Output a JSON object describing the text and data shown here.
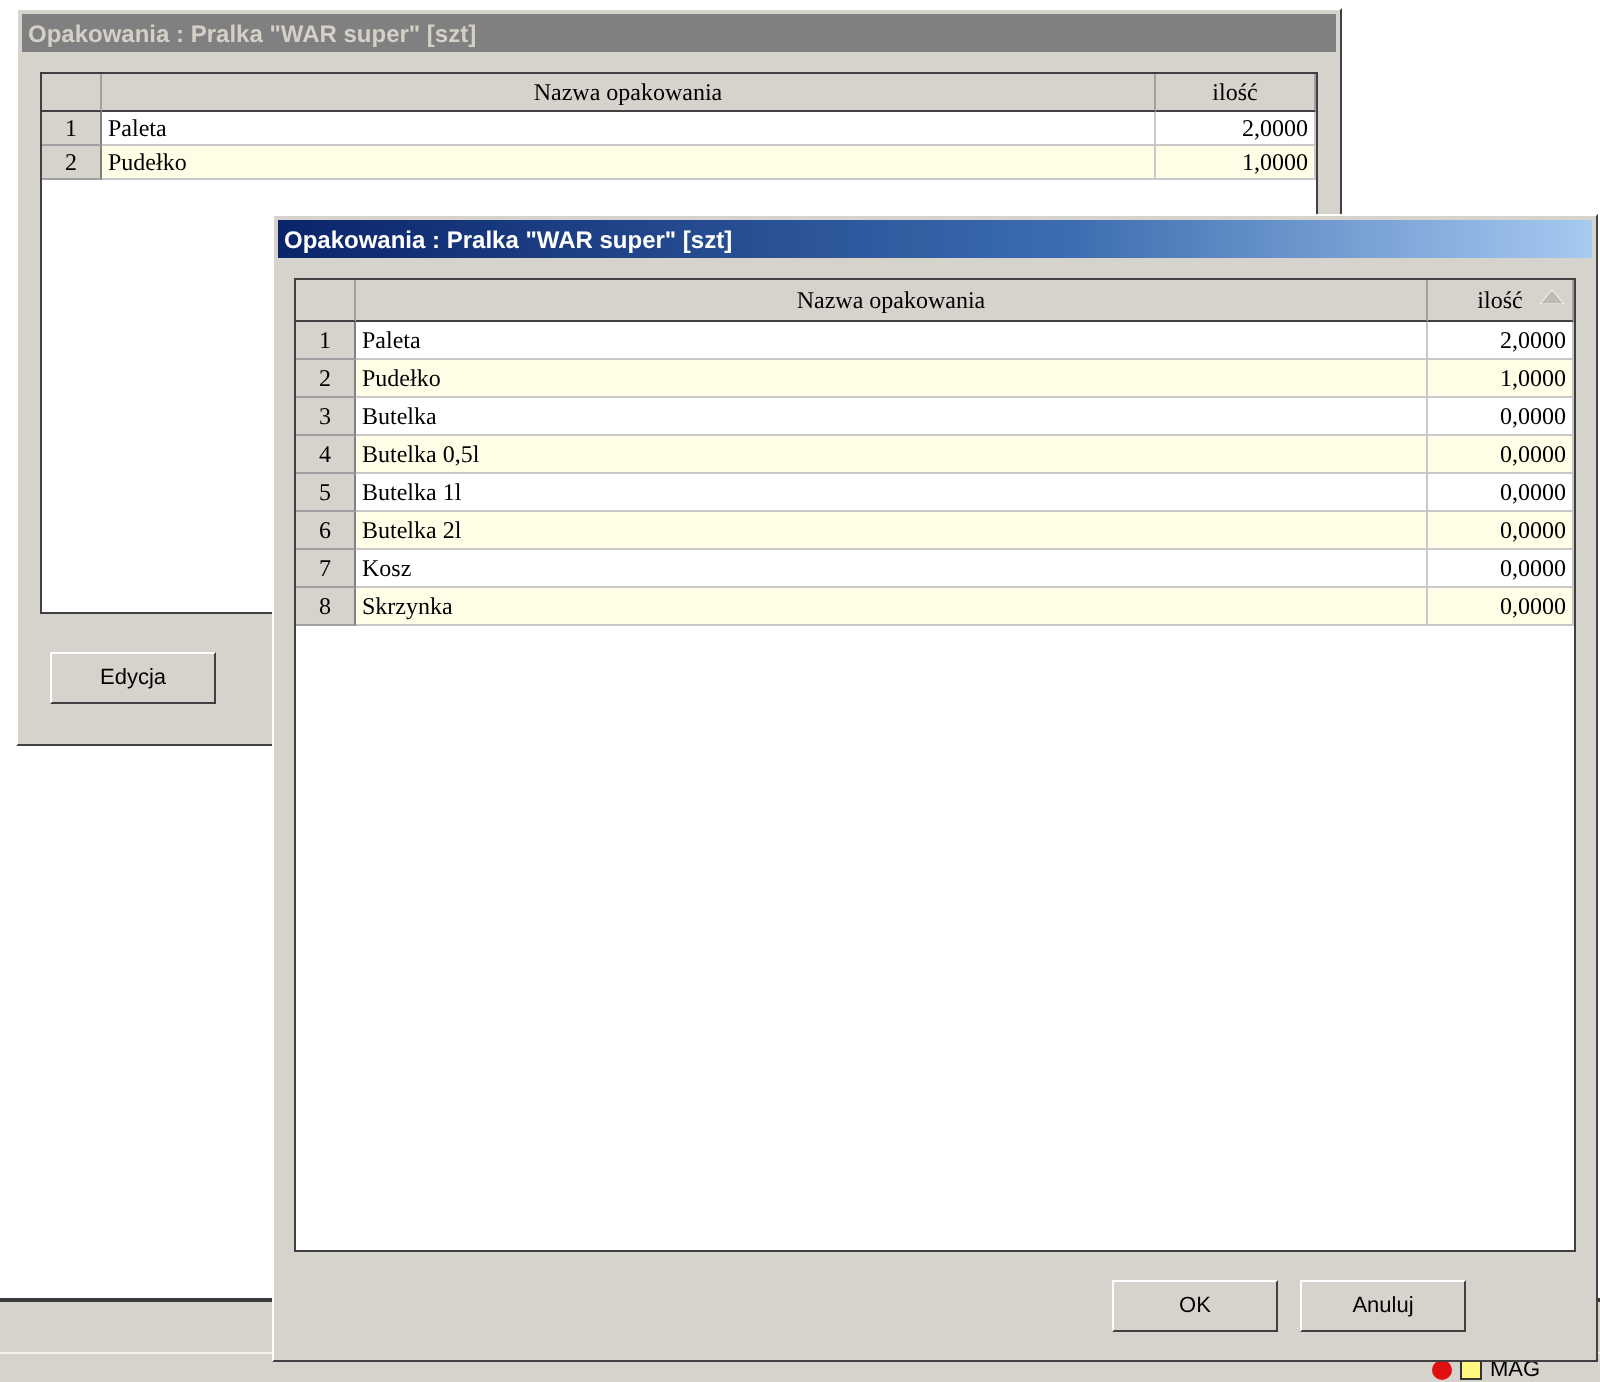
{
  "back_window": {
    "title": "Opakowania : Pralka \"WAR super\" [szt]",
    "active": false,
    "table": {
      "columns": [
        {
          "label": "Nazwa opakowania",
          "sorted": false
        },
        {
          "label": "ilość",
          "sorted": false
        }
      ],
      "rows": [
        {
          "index": "1",
          "name": "Paleta",
          "quantity": "2,0000"
        },
        {
          "index": "2",
          "name": "Pudełko",
          "quantity": "1,0000"
        }
      ]
    },
    "buttons": [
      "Edycja"
    ]
  },
  "front_window": {
    "title": "Opakowania : Pralka \"WAR super\" [szt]",
    "active": true,
    "table": {
      "columns": [
        {
          "label": "Nazwa opakowania",
          "sorted": false
        },
        {
          "label": "ilość",
          "sorted": true
        }
      ],
      "rows": [
        {
          "index": "1",
          "name": "Paleta",
          "quantity": "2,0000"
        },
        {
          "index": "2",
          "name": "Pudełko",
          "quantity": "1,0000"
        },
        {
          "index": "3",
          "name": "Butelka",
          "quantity": "0,0000"
        },
        {
          "index": "4",
          "name": "Butelka 0,5l",
          "quantity": "0,0000"
        },
        {
          "index": "5",
          "name": "Butelka 1l",
          "quantity": "0,0000"
        },
        {
          "index": "6",
          "name": "Butelka 2l",
          "quantity": "0,0000"
        },
        {
          "index": "7",
          "name": "Kosz",
          "quantity": "0,0000"
        },
        {
          "index": "8",
          "name": "Skrzynka",
          "quantity": "0,0000"
        }
      ]
    },
    "buttons": [
      "OK",
      "Anuluj"
    ]
  },
  "status_bar": {
    "text": "MAG"
  }
}
